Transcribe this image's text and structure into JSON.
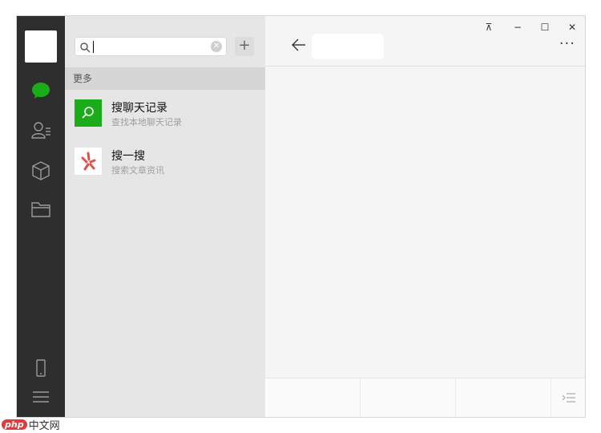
{
  "window": {
    "controls": {
      "pin": "⊼",
      "minimize": "−",
      "maximize": "☐",
      "close": "✕"
    }
  },
  "nav": {
    "items": [
      "chat-icon",
      "contacts-icon",
      "favorites-cube-icon",
      "folder-icon"
    ],
    "bottom": [
      "phone-icon",
      "menu-icon"
    ],
    "active_color": "#1aad19"
  },
  "search": {
    "value": "",
    "clear_label": "✕",
    "add_label": "+"
  },
  "results": {
    "section_label": "更多",
    "items": [
      {
        "title": "搜聊天记录",
        "subtitle": "查找本地聊天记录",
        "icon": "search-chat-icon",
        "icon_bg": "#1aad19"
      },
      {
        "title": "搜一搜",
        "subtitle": "搜索文章资讯",
        "icon": "sousou-icon",
        "icon_bg": "#ffffff"
      }
    ]
  },
  "chat": {
    "more_label": "···"
  },
  "watermark": {
    "brand": "php",
    "text": "中文网"
  }
}
